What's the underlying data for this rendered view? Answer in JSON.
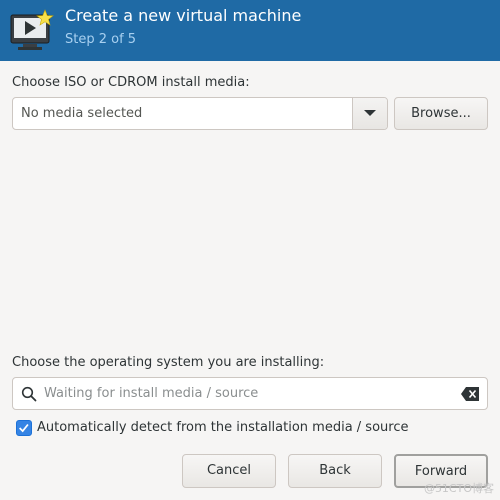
{
  "header": {
    "title": "Create a new virtual machine",
    "subtitle": "Step 2 of 5",
    "icon": "virtual-machine-icon"
  },
  "media": {
    "label": "Choose ISO or CDROM install media:",
    "selected": "No media selected",
    "browse_label": "Browse..."
  },
  "os": {
    "label": "Choose the operating system you are installing:",
    "search_placeholder": "Waiting for install media / source",
    "auto_detect_label": "Automatically detect from the installation media / source",
    "auto_detect_checked": true
  },
  "footer": {
    "cancel_label": "Cancel",
    "back_label": "Back",
    "forward_label": "Forward"
  },
  "watermark": "@51CTO博客",
  "colors": {
    "header_bg": "#1f6aa5",
    "accent": "#3584e4"
  }
}
